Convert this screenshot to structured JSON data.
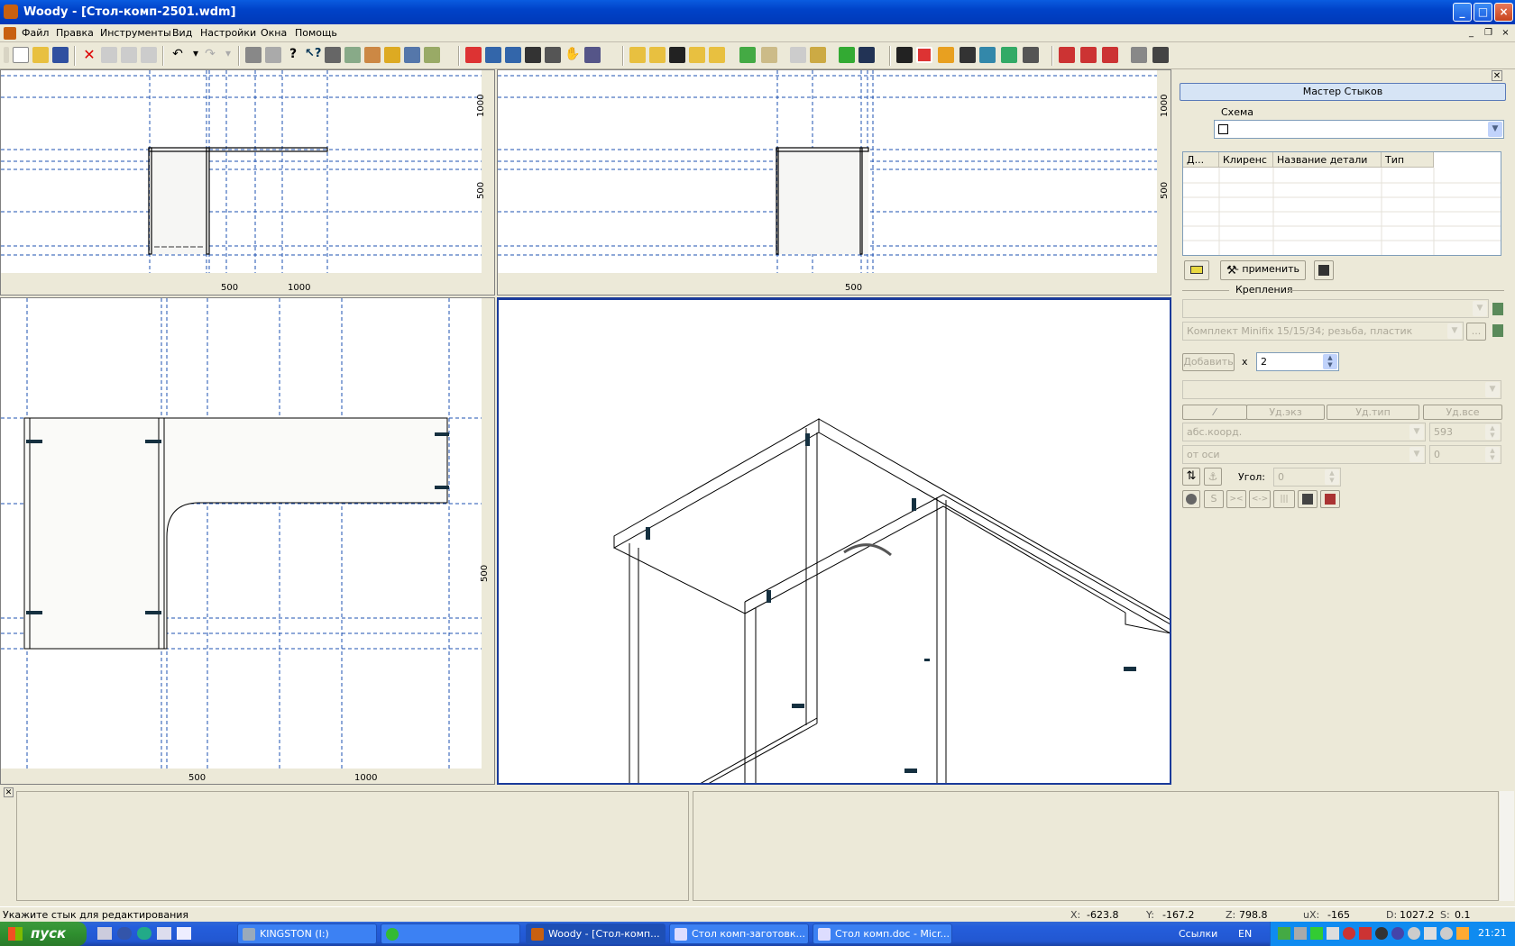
{
  "window": {
    "title": "Woody - [Стол-комп-2501.wdm]",
    "minimize": "_",
    "maximize": "□",
    "close": "×",
    "mdi_min": "_",
    "mdi_restore": "❐",
    "mdi_close": "×"
  },
  "menu": [
    "Файл",
    "Правка",
    "Инструменты",
    "Вид",
    "Настройки",
    "Окна",
    "Помощь"
  ],
  "viewports": {
    "front": {
      "ruler_x": [
        "500",
        "1000"
      ],
      "ruler_y": [
        "1000",
        "500"
      ]
    },
    "side": {
      "ruler_x": [
        "500"
      ],
      "ruler_y": [
        "1000",
        "500"
      ]
    },
    "top": {
      "ruler_x": [
        "500",
        "1000"
      ],
      "ruler_y": [
        "500"
      ]
    }
  },
  "panel": {
    "title": "Мастер Стыков",
    "schema_label": "Схема",
    "table_headers": [
      "Д...",
      "Клиренс",
      "Название детали",
      "Тип"
    ],
    "apply_label": "- применить",
    "fasteners_label": "Крепления",
    "fastener_kit": "Комплект Minifix 15/15/34; резьба, пластик",
    "add_label": "Добавить",
    "times": "x",
    "count": "2",
    "del_inst": "Уд.экз",
    "del_type": "Уд.тип",
    "del_all": "Уд.все",
    "coord_mode": "абс.коорд.",
    "coord_value": "593",
    "from_axis": "от оси",
    "axis_value": "0",
    "angle_label": "Угол:",
    "angle_value": "0",
    "s_label": "S",
    "btn_shrink": "><",
    "btn_expand": "<->",
    "btn_bars": "|||"
  },
  "status": {
    "hint": "Укажите стык для редактирования",
    "x_label": "X:",
    "x": "-623.8",
    "y_label": "Y:",
    "y": "-167.2",
    "z_label": "Z:",
    "z": "798.8",
    "ux_label": "uX:",
    "ux": "-165",
    "d_label": "D:",
    "d": "1027.2",
    "s_label": "S:",
    "s": "0.1"
  },
  "taskbar": {
    "start": "пуск",
    "tasks": [
      "KINGSTON (I:)",
      "",
      "Woody - [Стол-комп...",
      "Стол комп-заготовк...",
      "Стол комп.doc - Micr..."
    ],
    "links": "Ссылки",
    "lang": "EN",
    "clock": "21:21"
  }
}
